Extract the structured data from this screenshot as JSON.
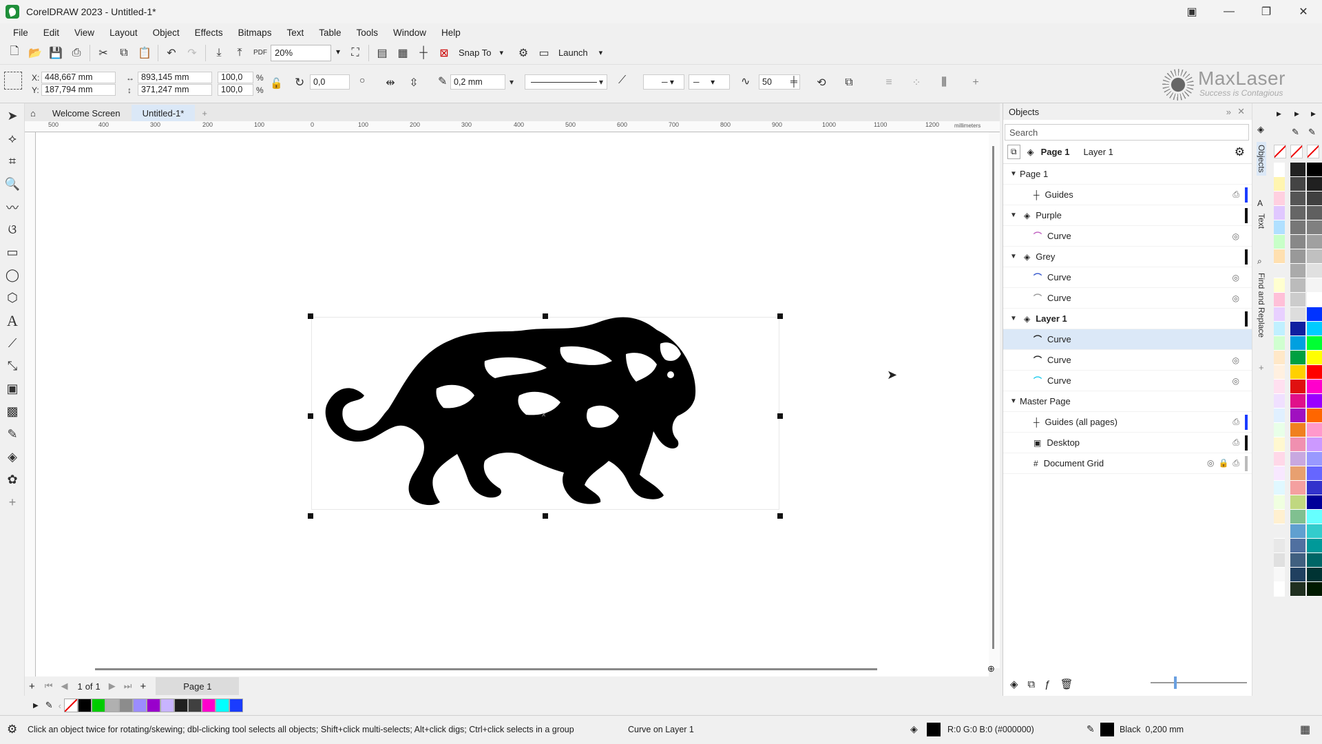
{
  "window": {
    "title": "CorelDRAW 2023 - Untitled-1*"
  },
  "menu": [
    "File",
    "Edit",
    "View",
    "Layout",
    "Object",
    "Effects",
    "Bitmaps",
    "Text",
    "Table",
    "Tools",
    "Window",
    "Help"
  ],
  "toolbar": {
    "zoom": "20%",
    "snap_to": "Snap To",
    "launch": "Launch"
  },
  "property_bar": {
    "x": "448,667 mm",
    "y": "187,794 mm",
    "width": "893,145 mm",
    "height": "371,247 mm",
    "scale_x": "100,0",
    "scale_y": "100,0",
    "pct": "%",
    "rotation": "0,0",
    "outline": "0,2 mm",
    "smoothing": "50"
  },
  "brand": {
    "name": "MaxLaser",
    "tagline": "Success is Contagious"
  },
  "tabs": [
    "Welcome Screen",
    "Untitled-1*"
  ],
  "ruler": {
    "ticks": [
      "500",
      "400",
      "300",
      "200",
      "100",
      "0",
      "100",
      "200",
      "300",
      "400",
      "500",
      "600",
      "700",
      "800",
      "900",
      "1000",
      "1100",
      "1200"
    ],
    "unit": "millimeters"
  },
  "pages": {
    "current": "1",
    "of": "of",
    "total": "1",
    "page_tab": "Page 1"
  },
  "objects_panel": {
    "title": "Objects",
    "search_placeholder": "Search",
    "page": "Page 1",
    "layer": "Layer 1",
    "tree": [
      {
        "label": "Page 1",
        "level": 0,
        "kind": "page"
      },
      {
        "label": "Guides",
        "level": 1,
        "kind": "guides",
        "color": "#1a3cff"
      },
      {
        "label": "Purple",
        "level": 0,
        "kind": "layer",
        "color": "#111111"
      },
      {
        "label": "Curve",
        "level": 1,
        "kind": "curve",
        "icon_color": "#c060c0"
      },
      {
        "label": "Grey",
        "level": 0,
        "kind": "layer",
        "color": "#111111"
      },
      {
        "label": "Curve",
        "level": 1,
        "kind": "curve",
        "icon_color": "#3355cc"
      },
      {
        "label": "Curve",
        "level": 1,
        "kind": "curve",
        "icon_color": "#999999"
      },
      {
        "label": "Layer 1",
        "level": 0,
        "kind": "layer",
        "color": "#111111"
      },
      {
        "label": "Curve",
        "level": 1,
        "kind": "curve",
        "icon_color": "#222222",
        "selected": true
      },
      {
        "label": "Curve",
        "level": 1,
        "kind": "curve",
        "icon_color": "#222222"
      },
      {
        "label": "Curve",
        "level": 1,
        "kind": "curve",
        "icon_color": "#22ccee"
      },
      {
        "label": "Master Page",
        "level": 0,
        "kind": "page"
      },
      {
        "label": "Guides (all pages)",
        "level": 1,
        "kind": "guides",
        "color": "#1a3cff"
      },
      {
        "label": "Desktop",
        "level": 1,
        "kind": "desktop",
        "color": "#111111"
      },
      {
        "label": "Document Grid",
        "level": 1,
        "kind": "grid",
        "color": "#bbbbbb"
      }
    ]
  },
  "dock_tabs": [
    "Objects",
    "Text",
    "Find and Replace"
  ],
  "status": {
    "hint": "Click an object twice for rotating/skewing; dbl-clicking tool selects all objects; Shift+click multi-selects; Alt+click digs; Ctrl+click selects in a group",
    "selection": "Curve on Layer 1",
    "fill": "R:0 G:0 B:0 (#000000)",
    "outline": "Black  0,200 mm"
  },
  "doc_palette": [
    "#ffffff",
    "#000000",
    "#00cc00",
    "#b0b0b0",
    "#8c8c8c",
    "#9b8cff",
    "#9900cc",
    "#c8b4ff",
    "#202020",
    "#404040",
    "#ff00cc",
    "#00ffff",
    "#1a3cff"
  ],
  "palette_col1": [
    "#ffffff",
    "#fff5b0",
    "#ffd0e0",
    "#e0c8ff",
    "#b0e0ff",
    "#c8ffc8",
    "#ffe0b0",
    "#f0f0f0",
    "#ffffd0",
    "#ffc0d8",
    "#e8d0ff",
    "#c0f0ff",
    "#d0ffd0",
    "#ffe8c8",
    "#fff0e0",
    "#ffe0f0",
    "#f0e0ff",
    "#e0f0ff",
    "#e8ffe8",
    "#fff8d0",
    "#ffd8e8",
    "#f8e8ff",
    "#e0f8ff",
    "#f0ffe0",
    "#fff0d0",
    "#f0f0f0",
    "#e8e8e8",
    "#e0e0e0",
    "#f8f8f8",
    "#ffffff"
  ],
  "palette_col2": [
    "#222222",
    "#444444",
    "#555555",
    "#666666",
    "#777777",
    "#888888",
    "#999999",
    "#aaaaaa",
    "#bbbbbb",
    "#cccccc",
    "#dddddd",
    "#1020a0",
    "#00a0e0",
    "#00a040",
    "#ffd000",
    "#e01010",
    "#e0108a",
    "#a010c0",
    "#f08020",
    "#f090b0",
    "#c8a8e0",
    "#e8a070",
    "#f4a0a0",
    "#c0d880",
    "#80c090",
    "#60a0d0",
    "#5070a0",
    "#406080",
    "#204060",
    "#203020"
  ],
  "palette_col3": [
    "#000000",
    "#202020",
    "#404040",
    "#606060",
    "#808080",
    "#a0a0a0",
    "#c0c0c0",
    "#e0e0e0",
    "#f4f4f4",
    "#ffffff",
    "#0033ff",
    "#00ccff",
    "#00ff33",
    "#ffff00",
    "#ff0000",
    "#ff00cc",
    "#9900ff",
    "#ff6600",
    "#ff99cc",
    "#cc99ff",
    "#9999ff",
    "#6666ff",
    "#3333cc",
    "#000099",
    "#66ffff",
    "#33cccc",
    "#009999",
    "#006666",
    "#003333",
    "#001a00"
  ]
}
